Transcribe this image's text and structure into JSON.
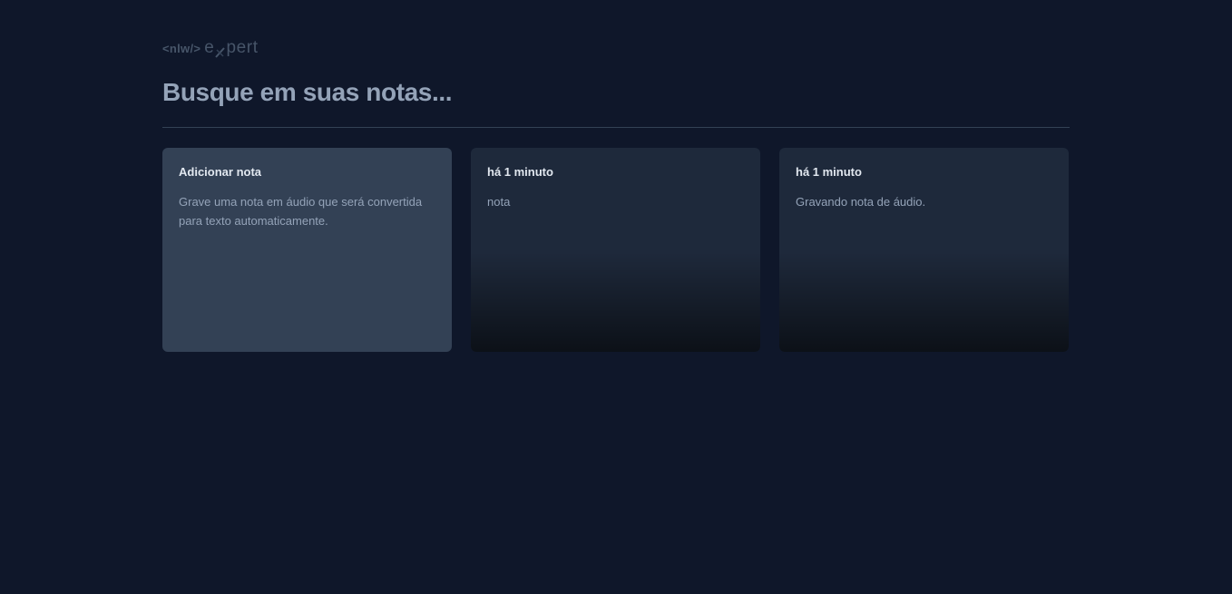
{
  "logo": {
    "tag": "<nlw/>",
    "word_left": "e",
    "word_right": "pert",
    "icon": "x-mark-icon"
  },
  "search": {
    "placeholder": "Busque em suas notas..."
  },
  "add_card": {
    "title": "Adicionar nota",
    "description": "Grave uma nota em áudio que será convertida para texto automaticamente."
  },
  "notes": [
    {
      "date": "há 1 minuto",
      "content": "nota"
    },
    {
      "date": "há 1 minuto",
      "content": "Gravando nota de áudio."
    }
  ],
  "colors": {
    "background": "#0f172a",
    "card": "#1e293b",
    "add_card": "#334155",
    "divider": "#334155",
    "logo": "#475569"
  }
}
